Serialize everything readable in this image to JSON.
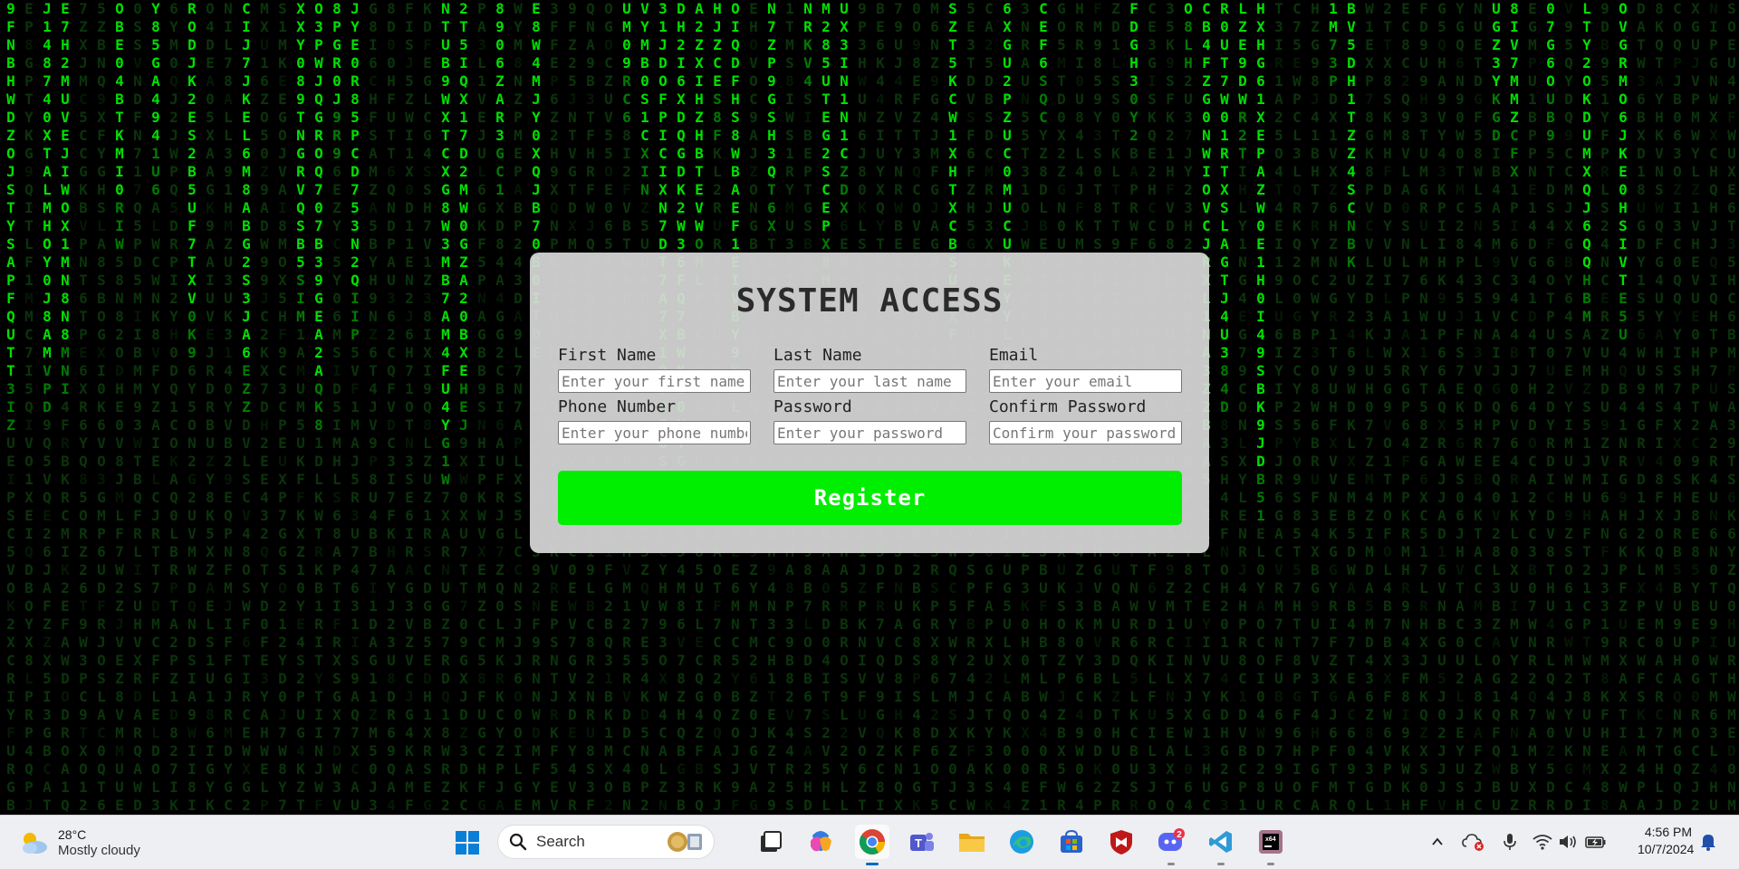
{
  "background": {
    "glyph_color_bright": "#00e000",
    "glyph_color_dim": "#0d3d0d",
    "columns": [
      "9FNBHWDZOJSTYSAPFQUTT3IZ",
      "E7H2MUVEJIWOX1MN8N8MNI",
      "RODJK2ES2B5UF7TXV0K9",
      "CIJ7JKEL6M8ABG2S3JA6EZZ",
      "XXY089TNGRVQSB5SIM",
      "NTUB9WXTCXG8W3MB7AM4FU4YG1W",
      "E8W4MJY0XQJB70B0ITDE",
      "VYMB0S1CXIN",
      "G90ORW",
      "N7ZP9GSH3QT6X",
      "NRKV4",
      "UX3IN1N1CZDX"
    ]
  },
  "form": {
    "title": "SYSTEM ACCESS",
    "first_name": {
      "label": "First Name",
      "placeholder": "Enter your first name"
    },
    "last_name": {
      "label": "Last Name",
      "placeholder": "Enter your last name"
    },
    "email": {
      "label": "Email",
      "placeholder": "Enter your email"
    },
    "phone": {
      "label": "Phone Number",
      "placeholder": "Enter your phone number"
    },
    "password": {
      "label": "Password",
      "placeholder": "Enter your password"
    },
    "confirm_password": {
      "label": "Confirm Password",
      "placeholder": "Confirm your password"
    },
    "register_label": "Register",
    "accent_color": "#00ee00"
  },
  "taskbar": {
    "weather": {
      "temp": "28°C",
      "condition": "Mostly cloudy",
      "icon": "partly-cloudy-icon"
    },
    "search_label": "Search",
    "apps": [
      {
        "name": "start",
        "icon": "windows-logo-icon"
      },
      {
        "name": "search-widget",
        "icon": "widgets-icon"
      },
      {
        "name": "task-view",
        "icon": "task-view-icon"
      },
      {
        "name": "copilot",
        "icon": "copilot-icon"
      },
      {
        "name": "chrome",
        "icon": "chrome-icon",
        "active": true
      },
      {
        "name": "teams",
        "icon": "teams-icon"
      },
      {
        "name": "file-explorer",
        "icon": "folder-icon"
      },
      {
        "name": "edge",
        "icon": "edge-icon"
      },
      {
        "name": "store",
        "icon": "store-icon"
      },
      {
        "name": "mcafee",
        "icon": "shield-icon"
      },
      {
        "name": "discord",
        "icon": "discord-icon",
        "badge": "2"
      },
      {
        "name": "vscode",
        "icon": "vscode-icon"
      },
      {
        "name": "pycharm",
        "icon": "pycharm-icon"
      }
    ],
    "tray": {
      "time": "4:56 PM",
      "date": "10/7/2024"
    }
  }
}
